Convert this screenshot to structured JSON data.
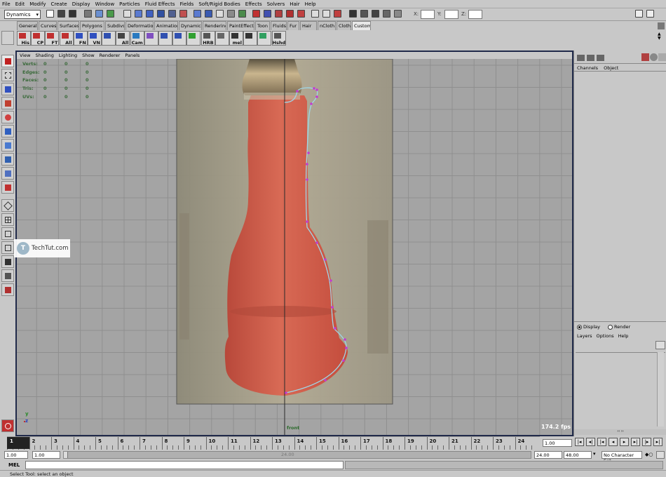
{
  "menu": [
    "File",
    "Edit",
    "Modify",
    "Create",
    "Display",
    "Window",
    "Particles",
    "Fluid Effects",
    "Fields",
    "Soft/Rigid Bodies",
    "Effects",
    "Solvers",
    "Hair",
    "Help"
  ],
  "status": {
    "mode": "Dynamics",
    "x_label": "X:",
    "y_label": "Y:",
    "z_label": "Z:"
  },
  "shelf_tabs": [
    "General",
    "Curves",
    "Surfaces",
    "Polygons",
    "Subdivs",
    "Deformation",
    "Animation",
    "Dynamics",
    "Rendering",
    "PaintEffects",
    "Toon",
    "Fluids",
    "Fur",
    "Hair",
    "nCloth",
    "Cloth",
    "Custom"
  ],
  "shelf_active": "Custom",
  "shelf_buttons": [
    {
      "label": "His",
      "icon": "history-icon"
    },
    {
      "label": "CP",
      "icon": "center-pivot-icon"
    },
    {
      "label": "FT",
      "icon": "freeze-transform-icon"
    },
    {
      "label": "All",
      "icon": "select-all-icon"
    },
    {
      "label": "FN",
      "icon": "facet-normals-icon"
    },
    {
      "label": "VN",
      "icon": "vertex-normals-icon"
    },
    {
      "label": "",
      "icon": "cube-icon"
    },
    {
      "label": "All",
      "icon": "all-icon"
    },
    {
      "label": "Cam",
      "icon": "camera-icon"
    },
    {
      "label": "",
      "icon": "hypershade-icon"
    },
    {
      "label": "",
      "icon": "material-icon"
    },
    {
      "label": "",
      "icon": "render-icon"
    },
    {
      "label": "",
      "icon": "play-icon"
    },
    {
      "label": "HRB",
      "icon": "render-buffer-icon"
    },
    {
      "label": "",
      "icon": "delete-icon"
    },
    {
      "label": "mel",
      "icon": "mel-script-icon"
    },
    {
      "label": "",
      "icon": "joint-icon"
    },
    {
      "label": "",
      "icon": "download-icon"
    },
    {
      "label": "Hshd",
      "icon": "hypershade-window-icon"
    }
  ],
  "panel_menu": [
    "View",
    "Shading",
    "Lighting",
    "Show",
    "Renderer",
    "Panels"
  ],
  "hud": [
    {
      "label": "Verts:",
      "values": [
        "0",
        "0",
        "0"
      ]
    },
    {
      "label": "Edges:",
      "values": [
        "0",
        "0",
        "0"
      ]
    },
    {
      "label": "Faces:",
      "values": [
        "0",
        "0",
        "0"
      ]
    },
    {
      "label": "Tris:",
      "values": [
        "0",
        "0",
        "0"
      ]
    },
    {
      "label": "UVs:",
      "values": [
        "0",
        "0",
        "0"
      ]
    }
  ],
  "camera_name": "front",
  "fps": "174.2 fps",
  "axis": {
    "y": "y",
    "z": "z"
  },
  "watermark": "TechTut.com",
  "channel_box": {
    "channels": "Channels",
    "object": "Object"
  },
  "layer_editor": {
    "display": "Display",
    "render": "Render",
    "menu": [
      "Layers",
      "Options",
      "Help"
    ]
  },
  "timeline": {
    "ticks": [
      "1",
      "2",
      "3",
      "4",
      "5",
      "6",
      "7",
      "8",
      "9",
      "10",
      "11",
      "12",
      "13",
      "14",
      "15",
      "16",
      "17",
      "18",
      "19",
      "20",
      "21",
      "22",
      "23",
      "24"
    ],
    "current": "1.00"
  },
  "range": {
    "start": "1.00",
    "inner_start": "1.00",
    "label": "24.00",
    "end_inner": "24.00",
    "end": "48.00",
    "character_set": "No Character Set"
  },
  "mel_label": "MEL",
  "help_line": "Select Tool: select an object",
  "colors": {
    "ui_bg": "#c8c8c8",
    "viewport_bg": "#a4a4a4",
    "bottle": "#d65a44",
    "curve": "#9fd7e8",
    "cv_point": "#c23bd0",
    "grid": "#8f8f8f",
    "panel_border": "#202a4a"
  }
}
